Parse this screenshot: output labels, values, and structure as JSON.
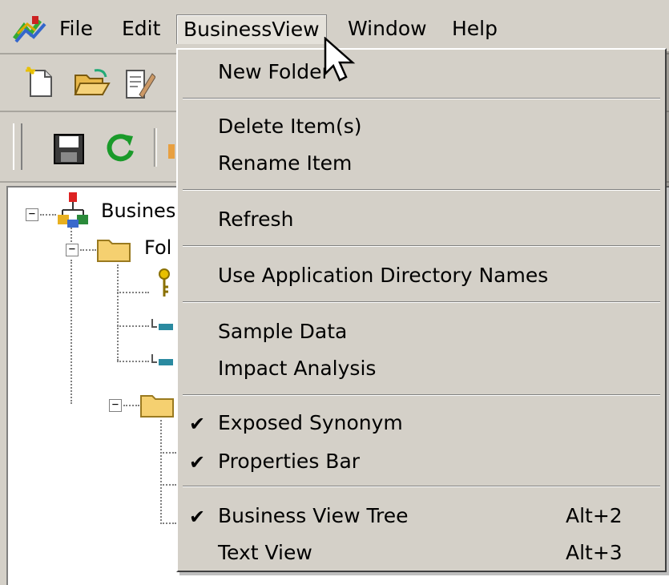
{
  "menubar": {
    "items": [
      {
        "label": "File"
      },
      {
        "label": "Edit"
      },
      {
        "label": "BusinessView"
      },
      {
        "label": "Window"
      },
      {
        "label": "Help"
      }
    ]
  },
  "tree": {
    "root_label": "Busines",
    "folder_label": "Fol"
  },
  "menu": {
    "items": [
      {
        "label": "New Folder"
      },
      {
        "label": "Delete Item(s)"
      },
      {
        "label": "Rename Item"
      },
      {
        "label": "Refresh"
      },
      {
        "label": "Use Application Directory Names"
      },
      {
        "label": "Sample Data"
      },
      {
        "label": "Impact Analysis"
      },
      {
        "label": "Exposed Synonym",
        "checked": true
      },
      {
        "label": "Properties Bar",
        "checked": true
      },
      {
        "label": "Business View Tree",
        "checked": true,
        "shortcut": "Alt+2"
      },
      {
        "label": "Text View",
        "shortcut": "Alt+3"
      }
    ],
    "check_glyph": "✔"
  },
  "icons": [
    "app-icon",
    "new-document-icon",
    "open-folder-icon",
    "edit-document-icon",
    "save-icon",
    "refresh-icon",
    "business-view-icon",
    "folder-icon",
    "key-icon",
    "field-icon",
    "mouse-cursor-icon"
  ]
}
